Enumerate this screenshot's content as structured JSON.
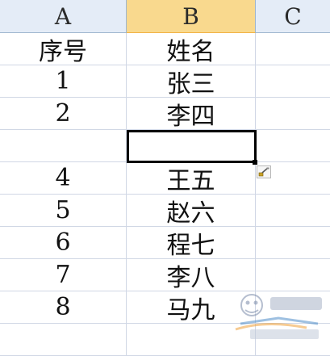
{
  "columns": {
    "a": "A",
    "b": "B",
    "c": "C"
  },
  "rows": [
    {
      "a": "序号",
      "b": "姓名"
    },
    {
      "a": "1",
      "b": "张三"
    },
    {
      "a": "2",
      "b": "李四"
    },
    {
      "a": "",
      "b": ""
    },
    {
      "a": "4",
      "b": "王五"
    },
    {
      "a": "5",
      "b": "赵六"
    },
    {
      "a": "6",
      "b": "程七"
    },
    {
      "a": "7",
      "b": "李八"
    },
    {
      "a": "8",
      "b": "马九"
    }
  ],
  "icons": {
    "paste_options": "paintbrush-icon"
  },
  "colors": {
    "selected_header": "#f9d98e",
    "header_bg": "#e4ecf7",
    "gridline": "#d0d7e5"
  }
}
